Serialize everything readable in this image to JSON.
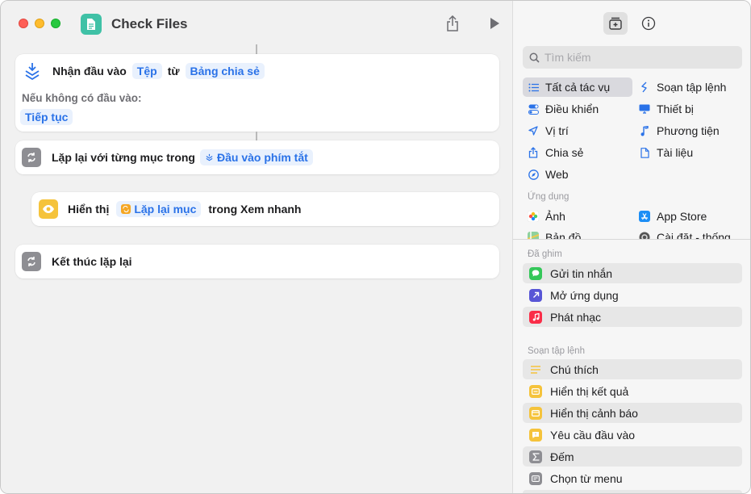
{
  "window": {
    "title": "Check Files"
  },
  "editor": {
    "receive": {
      "label": "Nhận đầu vào",
      "type_token": "Tệp",
      "from_label": "từ",
      "source_token": "Bảng chia sẻ",
      "no_input_label": "Nếu không có đầu vào:",
      "no_input_token": "Tiếp tục"
    },
    "repeat": {
      "label": "Lặp lại với từng mục trong",
      "token": "Đầu vào phím tắt"
    },
    "show": {
      "label": "Hiển thị",
      "token": "Lặp lại mục",
      "suffix": "trong Xem nhanh"
    },
    "end": {
      "label": "Kết thúc lặp lại"
    }
  },
  "sidebar": {
    "search_placeholder": "Tìm kiếm",
    "categories_left": [
      "Tất cả tác vụ",
      "Điều khiển",
      "Vị trí",
      "Chia sẻ",
      "Web"
    ],
    "categories_right": [
      "Soạn tập lệnh",
      "Thiết bị",
      "Phương tiện",
      "Tài liệu"
    ],
    "apps_header": "Ứng dụng",
    "apps": [
      "Ảnh",
      "App Store",
      "Bản đồ",
      "Cài đặt - thống"
    ],
    "pinned_header": "Đã ghim",
    "pinned": [
      "Gửi tin nhắn",
      "Mở ứng dụng",
      "Phát nhạc"
    ],
    "scripting_header": "Soạn tập lệnh",
    "scripting": [
      "Chú thích",
      "Hiển thị kết quả",
      "Hiển thị cảnh báo",
      "Yêu cầu đầu vào",
      "Đếm",
      "Chọn từ menu"
    ]
  },
  "colors": {
    "accent": "#2a72e8",
    "app_icon": "#3fc1a6",
    "repeat_icon": "#8e8e93",
    "show_icon": "#f5c33b"
  }
}
